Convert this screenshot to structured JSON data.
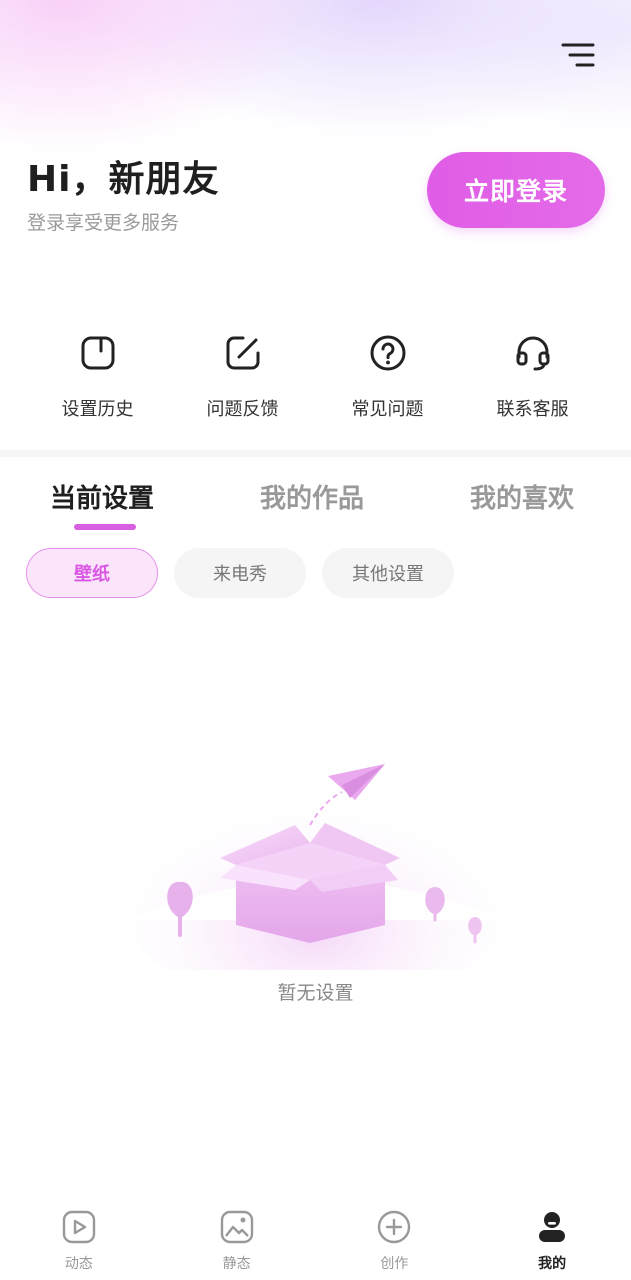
{
  "header": {
    "greeting": "Hi，新朋友",
    "subtitle": "登录享受更多服务",
    "login_label": "立即登录",
    "menu_icon": "menu-icon"
  },
  "quick_actions": [
    {
      "label": "设置历史",
      "icon": "history-icon"
    },
    {
      "label": "问题反馈",
      "icon": "edit-feedback-icon"
    },
    {
      "label": "常见问题",
      "icon": "question-icon"
    },
    {
      "label": "联系客服",
      "icon": "headset-icon"
    }
  ],
  "tabs": [
    {
      "label": "当前设置",
      "active": true
    },
    {
      "label": "我的作品",
      "active": false
    },
    {
      "label": "我的喜欢",
      "active": false
    }
  ],
  "filters": [
    {
      "label": "壁纸",
      "active": true
    },
    {
      "label": "来电秀",
      "active": false
    },
    {
      "label": "其他设置",
      "active": false
    }
  ],
  "empty_state": {
    "text": "暂无设置",
    "illustration": "empty-box-illustration"
  },
  "bottom_nav": [
    {
      "label": "动态",
      "icon": "video-icon",
      "active": false
    },
    {
      "label": "静态",
      "icon": "image-icon",
      "active": false
    },
    {
      "label": "创作",
      "icon": "plus-circle-icon",
      "active": false
    },
    {
      "label": "我的",
      "icon": "profile-icon",
      "active": true
    }
  ],
  "colors": {
    "accent": "#df5ce6",
    "chip_active_bg": "#fbe5fb",
    "text_primary": "#1f1f1f",
    "text_muted": "#999999"
  }
}
